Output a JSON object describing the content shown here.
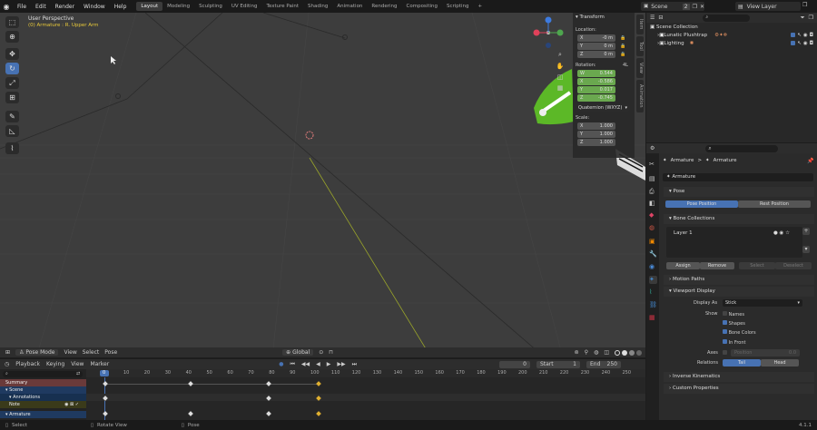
{
  "topbar": {
    "menus": [
      "File",
      "Edit",
      "Render",
      "Window",
      "Help"
    ],
    "workspaces": [
      "Layout",
      "Modeling",
      "Sculpting",
      "UV Editing",
      "Texture Paint",
      "Shading",
      "Animation",
      "Rendering",
      "Compositing",
      "Scripting"
    ],
    "active_workspace": "Layout",
    "add_tab": "+",
    "scene_label": "Scene",
    "scene_users": "2",
    "view_layer": "View Layer"
  },
  "viewport": {
    "perspective": "User Perspective",
    "active_object": "(0) Armature : R. Upper Arm",
    "header": {
      "mode": "Pose Mode",
      "view": "View",
      "select": "Select",
      "pose": "Pose",
      "transform_orientation": "Global"
    }
  },
  "npanel": {
    "tabs": [
      "Item",
      "Tool",
      "View",
      "Animation"
    ],
    "transform_title": "Transform",
    "location_label": "Location:",
    "location": [
      {
        "axis": "X",
        "value": "-0 m"
      },
      {
        "axis": "Y",
        "value": "0 m"
      },
      {
        "axis": "Z",
        "value": "0 m"
      }
    ],
    "rotation_label": "Rotation:",
    "rotation_mode_short": "4L",
    "rotation": [
      {
        "axis": "W",
        "value": "0.544"
      },
      {
        "axis": "X",
        "value": "-0.586"
      },
      {
        "axis": "Y",
        "value": "0.017"
      },
      {
        "axis": "Z",
        "value": "-0.745"
      }
    ],
    "rotation_mode": "Quaternion (WXYZ)",
    "scale_label": "Scale:",
    "scale": [
      {
        "axis": "X",
        "value": "1.000"
      },
      {
        "axis": "Y",
        "value": "1.000"
      },
      {
        "axis": "Z",
        "value": "1.000"
      }
    ]
  },
  "outliner": {
    "search_placeholder": "",
    "items": [
      {
        "name": "Scene Collection"
      },
      {
        "name": "Lunatic Plushtrap"
      },
      {
        "name": "Lighting"
      }
    ]
  },
  "properties": {
    "breadcrumb_left": "Armature",
    "breadcrumb_sep": ">",
    "breadcrumb_right": "Armature",
    "data_name": "Armature",
    "sections": {
      "pose": "Pose",
      "pose_position": "Pose Position",
      "rest_position": "Rest Position",
      "bone_collections": "Bone Collections",
      "layer": "Layer 1",
      "assign": "Assign",
      "remove": "Remove",
      "select": "Select",
      "deselect": "Deselect",
      "motion_paths": "Motion Paths",
      "viewport_display": "Viewport Display",
      "display_as_label": "Display As",
      "display_as_value": "Stick",
      "show_label": "Show",
      "names": "Names",
      "shapes": "Shapes",
      "bone_colors": "Bone Colors",
      "in_front": "In Front",
      "axes_label": "Axes",
      "position_label": "Position",
      "position_value": "0.0",
      "relations_label": "Relations",
      "tail": "Tail",
      "head": "Head",
      "inverse_kinematics": "Inverse Kinematics",
      "custom_properties": "Custom Properties"
    }
  },
  "timeline": {
    "menus": [
      "Playback",
      "Keying",
      "View",
      "Marker"
    ],
    "current_frame": "0",
    "start_label": "Start",
    "start": "1",
    "end_label": "End",
    "end": "250",
    "ticks": [
      "0",
      "10",
      "20",
      "30",
      "40",
      "50",
      "60",
      "70",
      "80",
      "90",
      "100",
      "110",
      "120",
      "130",
      "140",
      "150",
      "160",
      "170",
      "180",
      "190",
      "200",
      "210",
      "220",
      "230",
      "240",
      "250"
    ],
    "channels": [
      "Summary",
      "Scene",
      "Annotations",
      "Note",
      "Armature"
    ]
  },
  "statusbar": {
    "left": "Select",
    "middle1": "Rotate View",
    "middle2": "Pose",
    "version": "4.1.1"
  }
}
